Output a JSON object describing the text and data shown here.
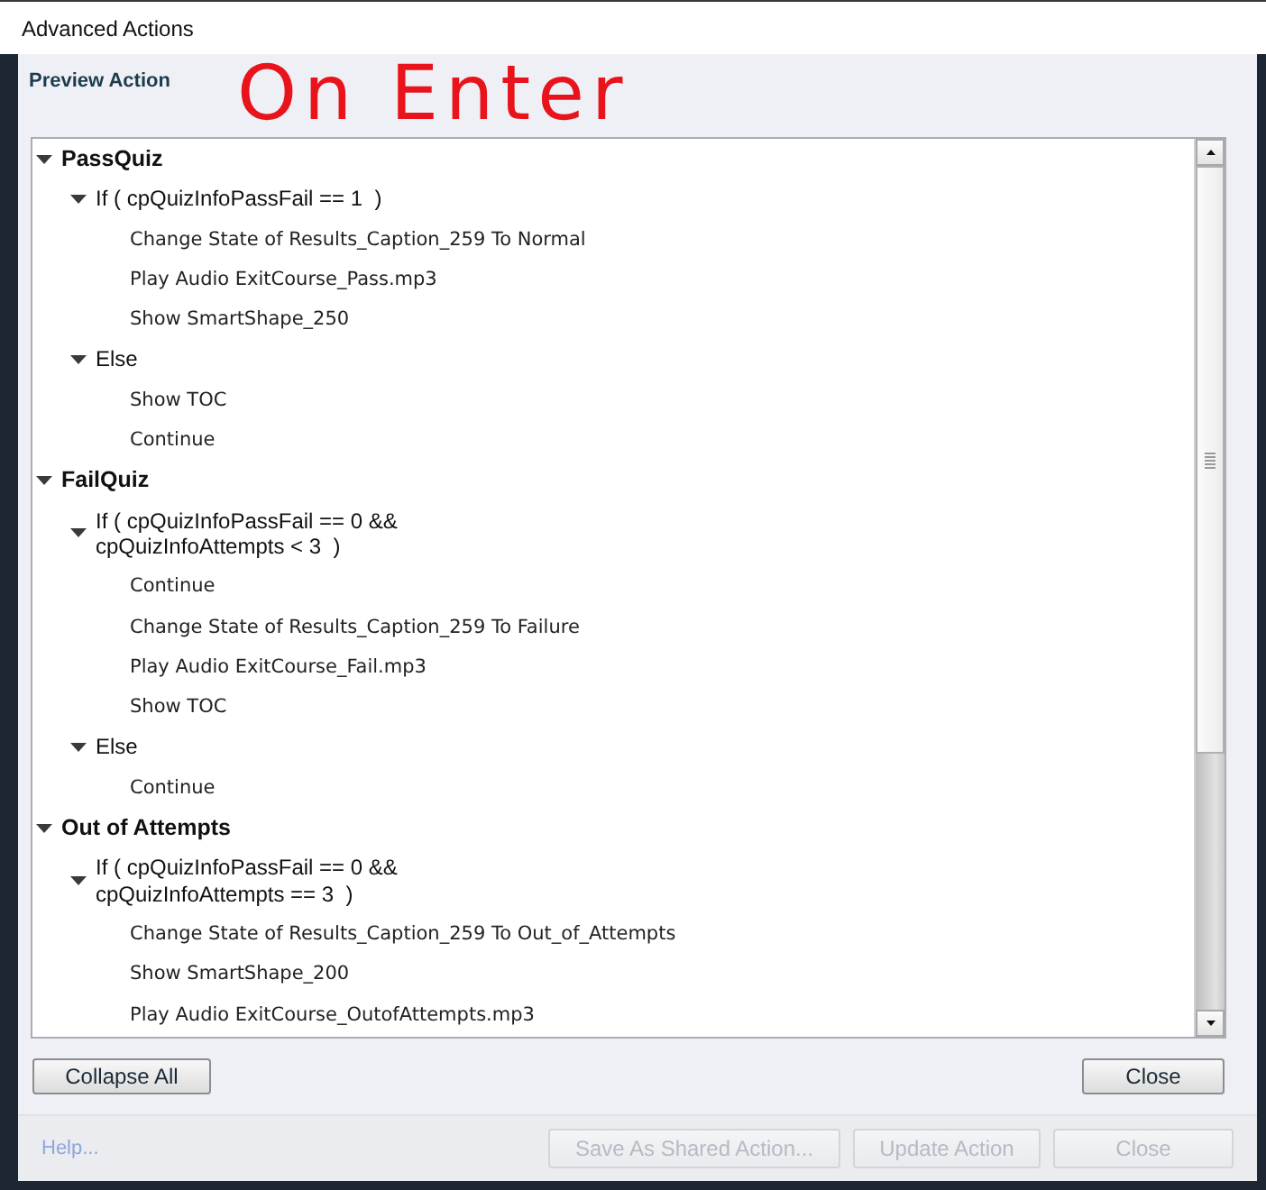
{
  "window": {
    "title": "Advanced Actions"
  },
  "header": {
    "label": "Preview Action",
    "annotation": "On Enter"
  },
  "tree": [
    {
      "label": "PassQuiz",
      "expanded": true,
      "children": [
        {
          "label": "If ( cpQuizInfoPassFail == 1  )",
          "expanded": true,
          "children": [
            {
              "label": "Change State of Results_Caption_259 To Normal"
            },
            {
              "label": "Play Audio ExitCourse_Pass.mp3"
            },
            {
              "label": "Show SmartShape_250"
            }
          ]
        },
        {
          "label": "Else",
          "expanded": true,
          "children": [
            {
              "label": "Show TOC"
            },
            {
              "label": "Continue"
            }
          ]
        }
      ]
    },
    {
      "label": "FailQuiz",
      "expanded": true,
      "children": [
        {
          "label": "If ( cpQuizInfoPassFail == 0 &&\ncpQuizInfoAttempts < 3  )",
          "expanded": true,
          "children": [
            {
              "label": "Continue"
            },
            {
              "label": "Change State of Results_Caption_259 To Failure"
            },
            {
              "label": "Play Audio ExitCourse_Fail.mp3"
            },
            {
              "label": "Show TOC"
            }
          ]
        },
        {
          "label": "Else",
          "expanded": true,
          "children": [
            {
              "label": "Continue"
            }
          ]
        }
      ]
    },
    {
      "label": "Out of Attempts",
      "expanded": true,
      "children": [
        {
          "label": "If ( cpQuizInfoPassFail == 0 &&\ncpQuizInfoAttempts == 3  )",
          "expanded": true,
          "children": [
            {
              "label": "Change State of Results_Caption_259 To Out_of_Attempts"
            },
            {
              "label": "Show SmartShape_200"
            },
            {
              "label": "Play Audio ExitCourse_OutofAttempts.mp3"
            }
          ]
        }
      ]
    }
  ],
  "panel_buttons": [
    {
      "label": "Collapse All"
    },
    {
      "label": "Close"
    }
  ],
  "footer": {
    "help_link": "Help...",
    "buttons": [
      {
        "label": "Save As Shared Action...",
        "disabled": true
      },
      {
        "label": "Update Action",
        "disabled": true
      },
      {
        "label": "Close",
        "disabled": true
      }
    ]
  }
}
